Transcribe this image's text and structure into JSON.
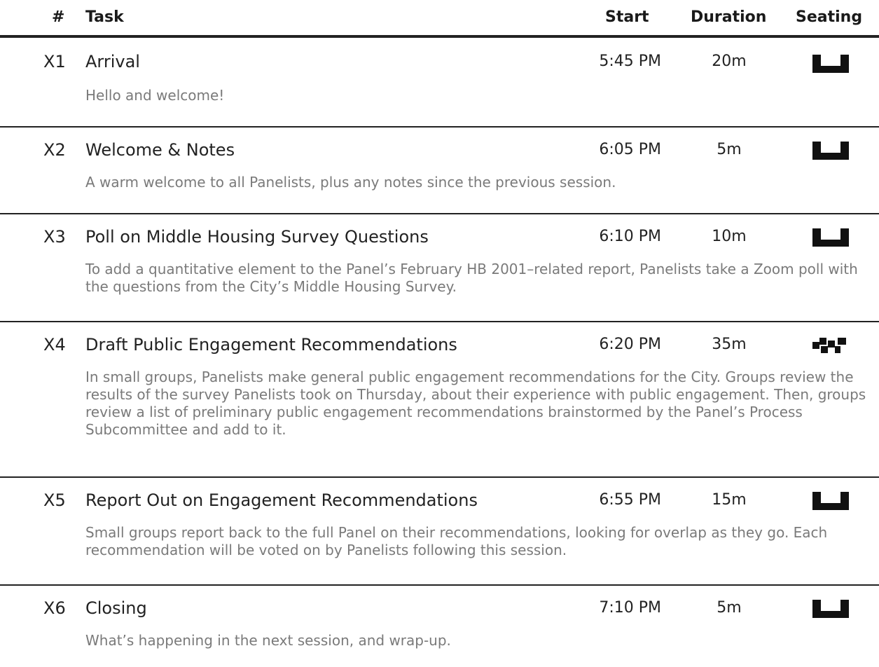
{
  "header": {
    "num": "#",
    "task": "Task",
    "start": "Start",
    "duration": "Duration",
    "seating": "Seating"
  },
  "rows": [
    {
      "id": "X1",
      "title": "Arrival",
      "start": "5:45 PM",
      "duration": "20m",
      "seating": "plenary-seating-icon",
      "description": "Hello and welcome!"
    },
    {
      "id": "X2",
      "title": "Welcome & Notes",
      "start": "6:05 PM",
      "duration": "5m",
      "seating": "plenary-seating-icon",
      "description": "A warm welcome to all Panelists, plus any notes since the previous session."
    },
    {
      "id": "X3",
      "title": "Poll on Middle Housing Survey Questions",
      "start": "6:10 PM",
      "duration": "10m",
      "seating": "plenary-seating-icon",
      "description": "To add a quantitative element to the Panel’s February HB 2001–related report, Panelists take a Zoom poll with the questions from the City’s Middle Housing Survey."
    },
    {
      "id": "X4",
      "title": "Draft Public Engagement Recommendations",
      "start": "6:20 PM",
      "duration": "35m",
      "seating": "small-groups-seating-icon",
      "description": "In small groups, Panelists make general public engagement recommendations for the City. Groups review the results of the survey Panelists took on Thursday, about their experience with public engagement. Then, groups review a list of preliminary public engagement recommendations brainstormed by the Panel’s Process Subcommittee and add to it."
    },
    {
      "id": "X5",
      "title": "Report Out on Engagement Recommendations",
      "start": "6:55 PM",
      "duration": "15m",
      "seating": "plenary-seating-icon",
      "description": "Small groups report back to the full Panel on their recommendations, looking for overlap as they go. Each recommendation will be voted on by Panelists following this session."
    },
    {
      "id": "X6",
      "title": "Closing",
      "start": "7:10 PM",
      "duration": "5m",
      "seating": "plenary-seating-icon",
      "description": "What’s happening in the next session, and wrap-up."
    }
  ]
}
